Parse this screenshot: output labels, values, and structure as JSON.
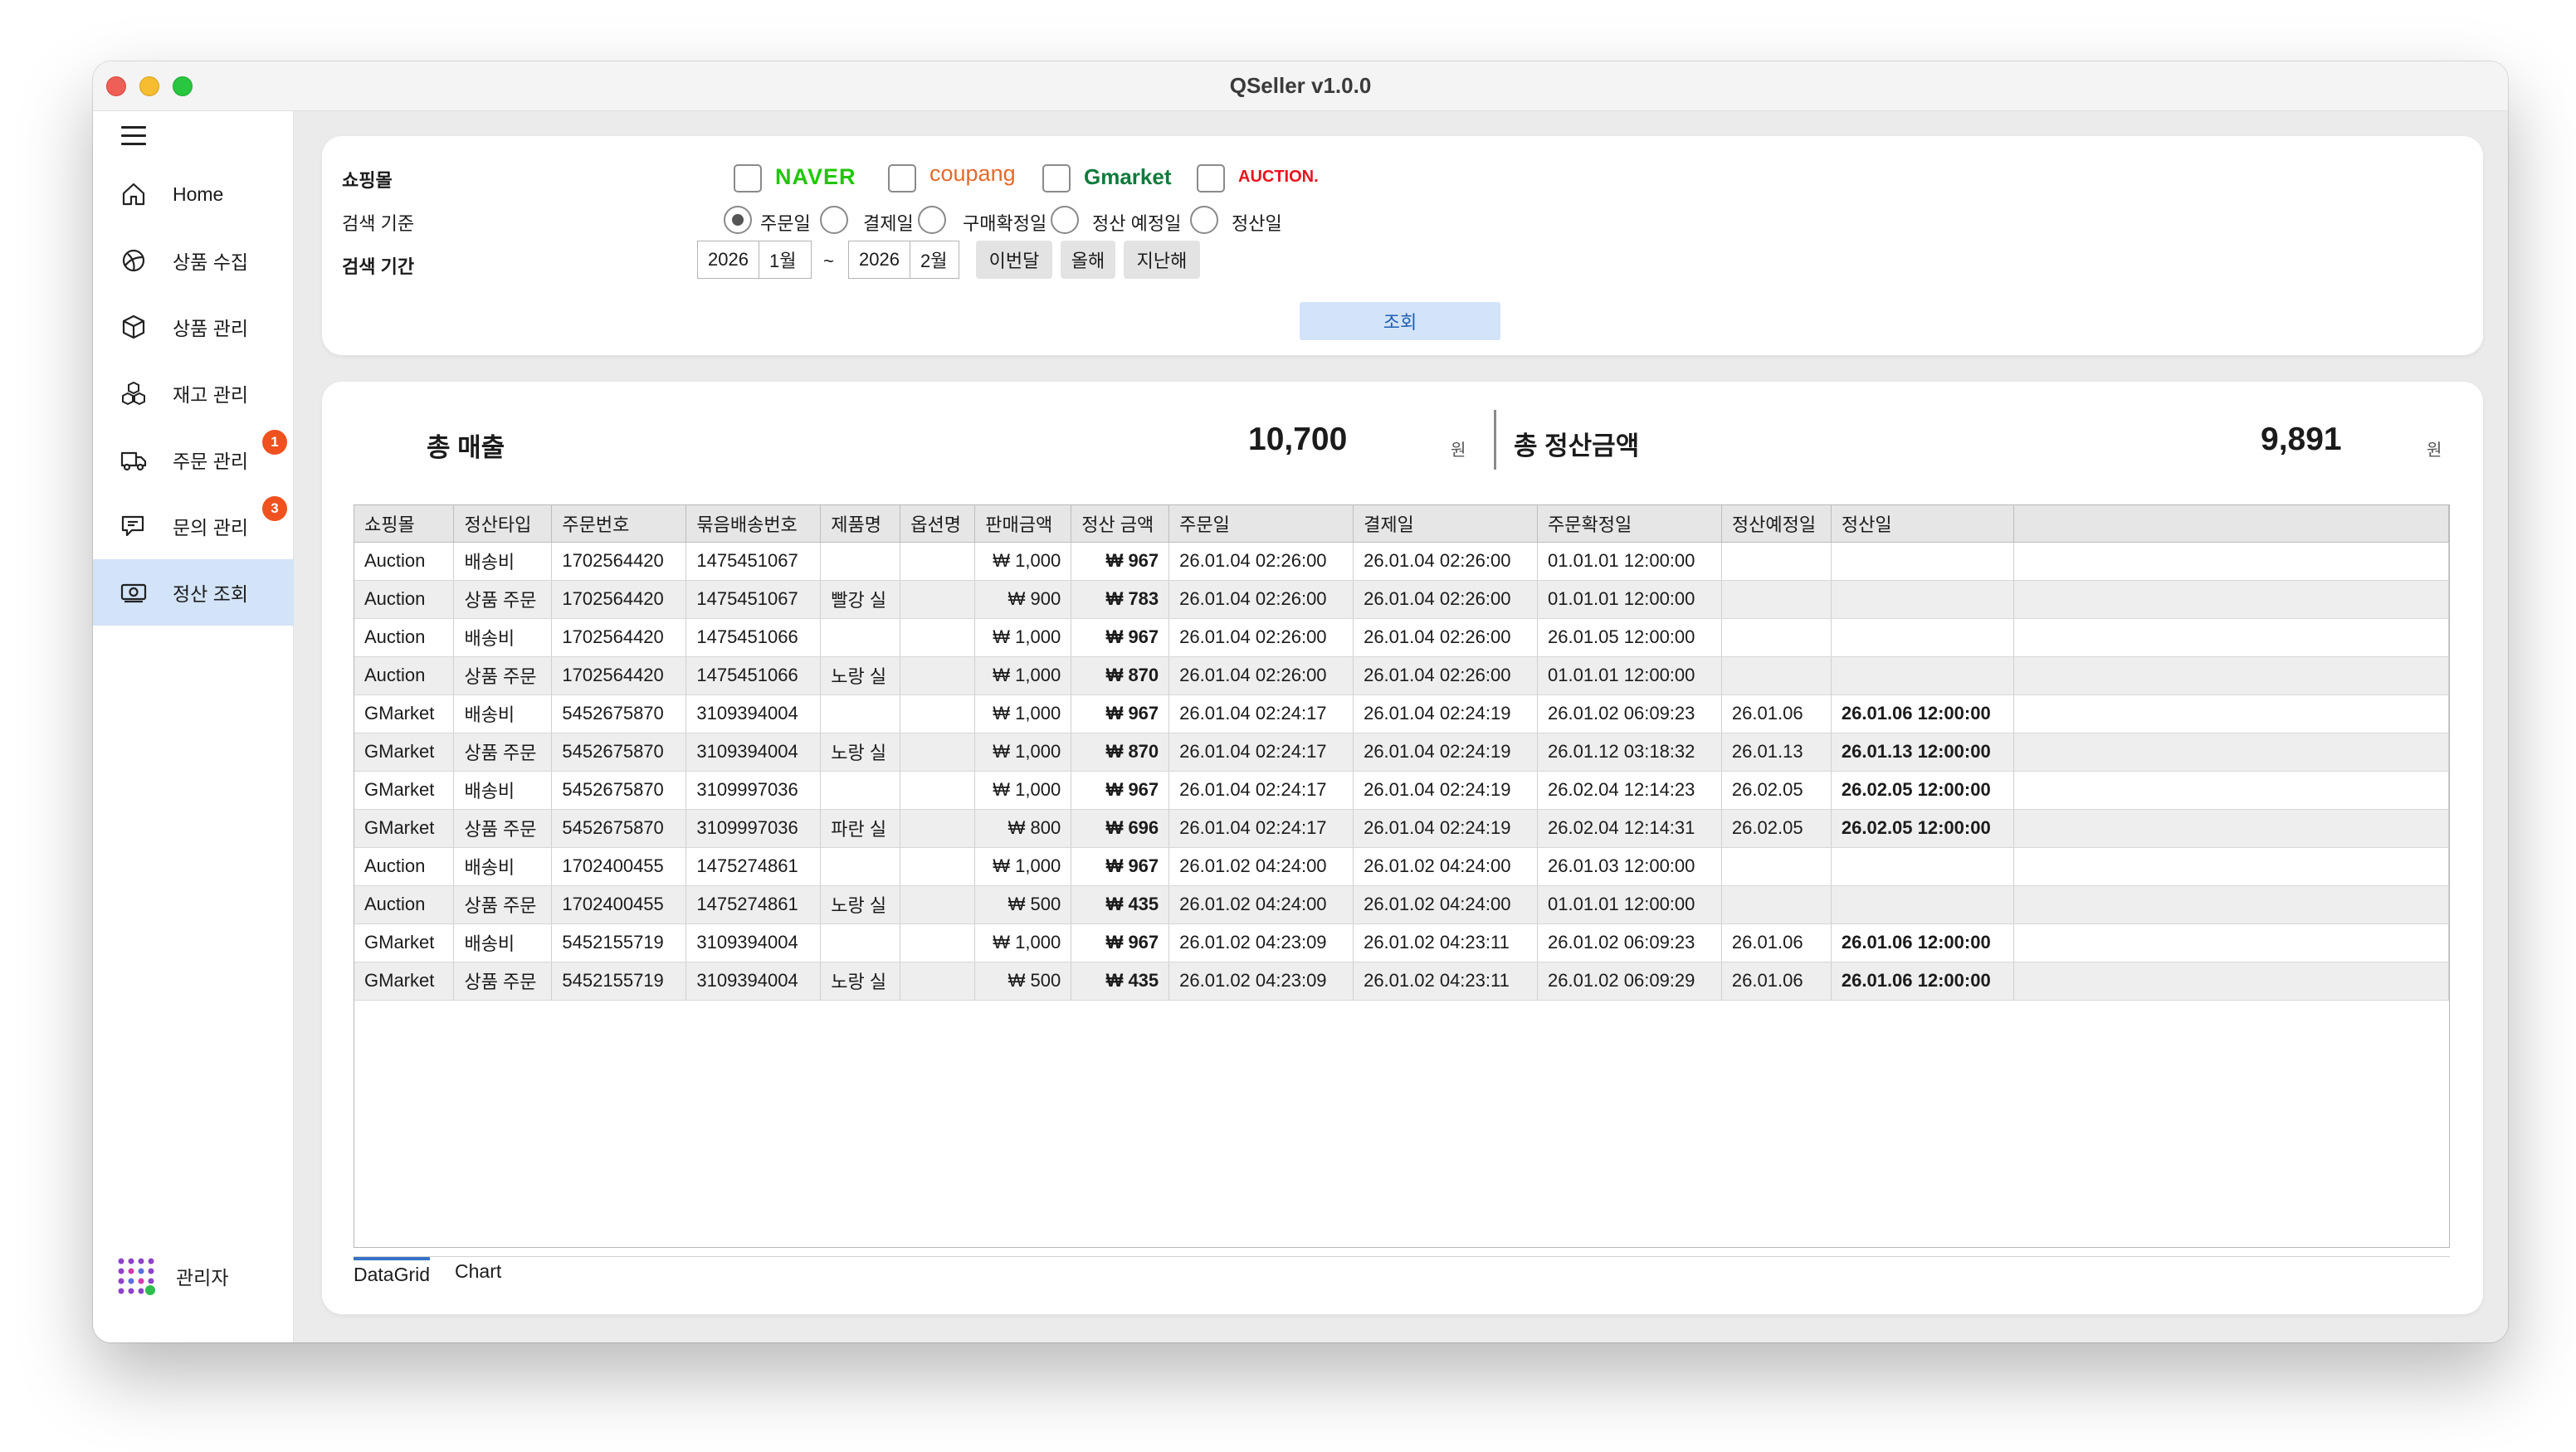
{
  "window": {
    "title": "QSeller v1.0.0"
  },
  "sidebar": {
    "items": [
      {
        "label": "Home",
        "icon": "home-icon"
      },
      {
        "label": "상품 수집",
        "icon": "globe-icon"
      },
      {
        "label": "상품 관리",
        "icon": "box-icon"
      },
      {
        "label": "재고 관리",
        "icon": "boxes-icon"
      },
      {
        "label": "주문 관리",
        "icon": "truck-icon",
        "badge": "1"
      },
      {
        "label": "문의 관리",
        "icon": "chat-icon",
        "badge": "3"
      },
      {
        "label": "정산 조회",
        "icon": "money-icon",
        "active": true
      }
    ],
    "admin": {
      "label": "관리자",
      "status_color": "#2dbe4e"
    }
  },
  "search": {
    "mall_label": "쇼핑몰",
    "malls": [
      {
        "name": "NAVER",
        "checked": false,
        "color": "#1ec800"
      },
      {
        "name": "coupang",
        "checked": false,
        "color": "#e36a2a"
      },
      {
        "name": "Gmarket",
        "checked": false,
        "color": "#0f7a3c"
      },
      {
        "name": "AUCTION.",
        "checked": false,
        "color": "#e8141e"
      }
    ],
    "basis_label": "검색 기준",
    "basis_options": [
      {
        "label": "주문일",
        "selected": true
      },
      {
        "label": "결제일",
        "selected": false
      },
      {
        "label": "구매확정일",
        "selected": false
      },
      {
        "label": "정산 예정일",
        "selected": false
      },
      {
        "label": "정산일",
        "selected": false
      }
    ],
    "period_label": "검색 기간",
    "from_year": "2026",
    "from_month": "1월",
    "tilde": "~",
    "to_year": "2026",
    "to_month": "2월",
    "quick_buttons": [
      "이번달",
      "올해",
      "지난해"
    ],
    "submit_label": "조회"
  },
  "summary": {
    "total_sales_label": "총 매출",
    "total_sales_value": "10,700",
    "total_settle_label": "총 정산금액",
    "total_settle_value": "9,891",
    "unit": "원"
  },
  "grid": {
    "columns": [
      "쇼핑몰",
      "정산타입",
      "주문번호",
      "묶음배송번호",
      "제품명",
      "옵션명",
      "판매금액",
      "정산 금액",
      "주문일",
      "결제일",
      "주문확정일",
      "정산예정일",
      "정산일"
    ],
    "rows": [
      [
        "Auction",
        "배송비",
        "1702564420",
        "1475451067",
        "",
        "",
        "₩ 1,000",
        "₩ 967",
        "26.01.04 02:26:00",
        "26.01.04 02:26:00",
        "01.01.01 12:00:00",
        "",
        ""
      ],
      [
        "Auction",
        "상품 주문",
        "1702564420",
        "1475451067",
        "빨강 실",
        "",
        "₩ 900",
        "₩ 783",
        "26.01.04 02:26:00",
        "26.01.04 02:26:00",
        "01.01.01 12:00:00",
        "",
        ""
      ],
      [
        "Auction",
        "배송비",
        "1702564420",
        "1475451066",
        "",
        "",
        "₩ 1,000",
        "₩ 967",
        "26.01.04 02:26:00",
        "26.01.04 02:26:00",
        "26.01.05 12:00:00",
        "",
        ""
      ],
      [
        "Auction",
        "상품 주문",
        "1702564420",
        "1475451066",
        "노랑 실",
        "",
        "₩ 1,000",
        "₩ 870",
        "26.01.04 02:26:00",
        "26.01.04 02:26:00",
        "01.01.01 12:00:00",
        "",
        ""
      ],
      [
        "GMarket",
        "배송비",
        "5452675870",
        "3109394004",
        "",
        "",
        "₩ 1,000",
        "₩ 967",
        "26.01.04 02:24:17",
        "26.01.04 02:24:19",
        "26.01.02 06:09:23",
        "26.01.06",
        "26.01.06 12:00:00"
      ],
      [
        "GMarket",
        "상품 주문",
        "5452675870",
        "3109394004",
        "노랑 실",
        "",
        "₩ 1,000",
        "₩ 870",
        "26.01.04 02:24:17",
        "26.01.04 02:24:19",
        "26.01.12 03:18:32",
        "26.01.13",
        "26.01.13 12:00:00"
      ],
      [
        "GMarket",
        "배송비",
        "5452675870",
        "3109997036",
        "",
        "",
        "₩ 1,000",
        "₩ 967",
        "26.01.04 02:24:17",
        "26.01.04 02:24:19",
        "26.02.04 12:14:23",
        "26.02.05",
        "26.02.05 12:00:00"
      ],
      [
        "GMarket",
        "상품 주문",
        "5452675870",
        "3109997036",
        "파란 실",
        "",
        "₩ 800",
        "₩ 696",
        "26.01.04 02:24:17",
        "26.01.04 02:24:19",
        "26.02.04 12:14:31",
        "26.02.05",
        "26.02.05 12:00:00"
      ],
      [
        "Auction",
        "배송비",
        "1702400455",
        "1475274861",
        "",
        "",
        "₩ 1,000",
        "₩ 967",
        "26.01.02 04:24:00",
        "26.01.02 04:24:00",
        "26.01.03 12:00:00",
        "",
        ""
      ],
      [
        "Auction",
        "상품 주문",
        "1702400455",
        "1475274861",
        "노랑 실",
        "",
        "₩ 500",
        "₩ 435",
        "26.01.02 04:24:00",
        "26.01.02 04:24:00",
        "01.01.01 12:00:00",
        "",
        ""
      ],
      [
        "GMarket",
        "배송비",
        "5452155719",
        "3109394004",
        "",
        "",
        "₩ 1,000",
        "₩ 967",
        "26.01.02 04:23:09",
        "26.01.02 04:23:11",
        "26.01.02 06:09:23",
        "26.01.06",
        "26.01.06 12:00:00"
      ],
      [
        "GMarket",
        "상품 주문",
        "5452155719",
        "3109394004",
        "노랑 실",
        "",
        "₩ 500",
        "₩ 435",
        "26.01.02 04:23:09",
        "26.01.02 04:23:11",
        "26.01.02 06:09:29",
        "26.01.06",
        "26.01.06 12:00:00"
      ]
    ]
  },
  "tabs": [
    {
      "label": "DataGrid",
      "active": true
    },
    {
      "label": "Chart",
      "active": false
    }
  ],
  "colors": {
    "accent": "#3773c5",
    "selected_bg": "#d3e3f8",
    "badge": "#f0511f"
  }
}
